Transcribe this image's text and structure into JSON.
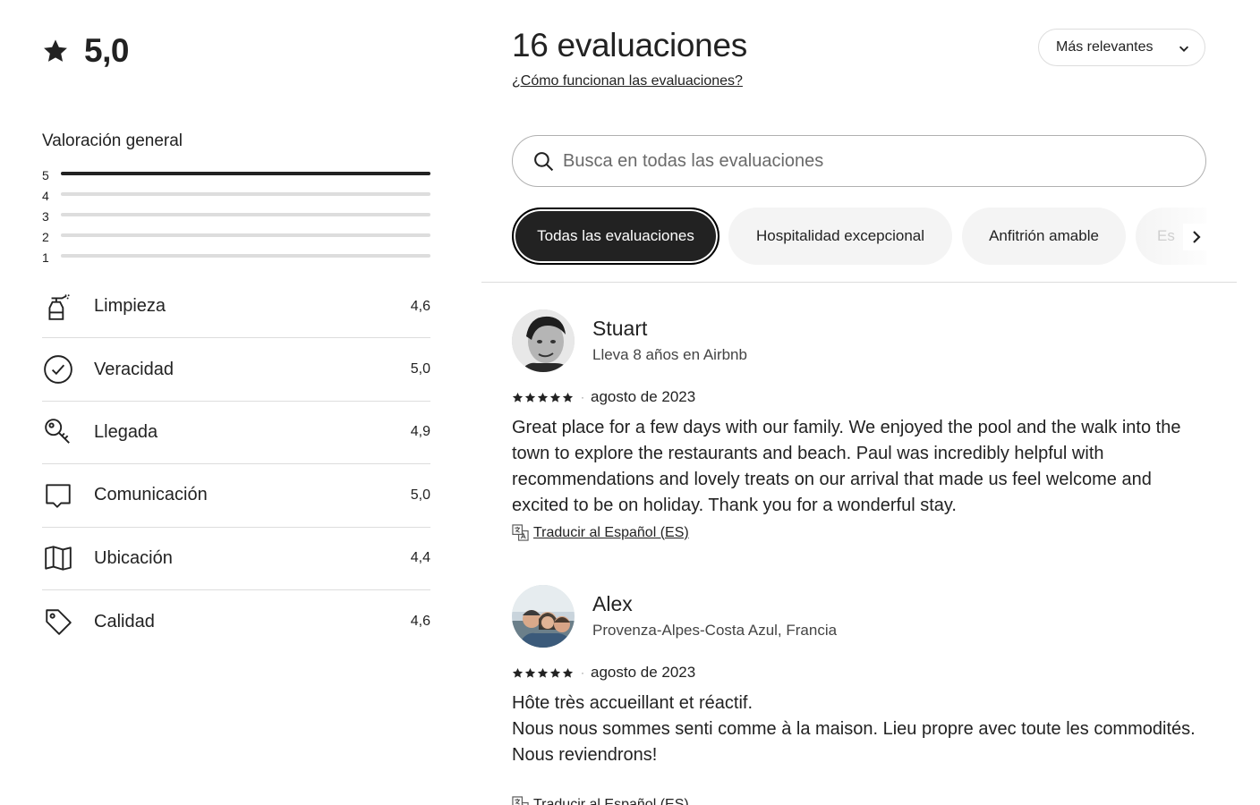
{
  "overall": {
    "rating": "5,0",
    "icon": "star-icon"
  },
  "distribution": {
    "title": "Valoración general",
    "rows": [
      {
        "stars": "5",
        "fraction": 1.0
      },
      {
        "stars": "4",
        "fraction": 0.0
      },
      {
        "stars": "3",
        "fraction": 0.0
      },
      {
        "stars": "2",
        "fraction": 0.0
      },
      {
        "stars": "1",
        "fraction": 0.0
      }
    ]
  },
  "categories": [
    {
      "label": "Limpieza",
      "value": "4,6",
      "icon": "spray-bottle-icon"
    },
    {
      "label": "Veracidad",
      "value": "5,0",
      "icon": "check-circle-icon"
    },
    {
      "label": "Llegada",
      "value": "4,9",
      "icon": "key-icon"
    },
    {
      "label": "Comunicación",
      "value": "5,0",
      "icon": "chat-bubble-icon"
    },
    {
      "label": "Ubicación",
      "value": "4,4",
      "icon": "map-icon"
    },
    {
      "label": "Calidad",
      "value": "4,6",
      "icon": "tag-icon"
    }
  ],
  "header": {
    "title": "16 evaluaciones",
    "how_link": "¿Cómo funcionan las evaluaciones?",
    "sort_label": "Más relevantes"
  },
  "search": {
    "placeholder": "Busca en todas las evaluaciones"
  },
  "chips": [
    {
      "label": "Todas las evaluaciones",
      "active": true
    },
    {
      "label": "Hospitalidad excepcional",
      "active": false
    },
    {
      "label": "Anfitrión amable",
      "active": false
    },
    {
      "label": "Es",
      "active": false
    }
  ],
  "reviews": [
    {
      "name": "Stuart",
      "subtitle": "Lleva 8 años en Airbnb",
      "stars": 5,
      "date": "agosto de 2023",
      "body": "Great place for a few days with our family. We enjoyed the pool and the walk into the town to explore the restaurants and beach. Paul was incredibly helpful with recommendations and lovely treats on our arrival that made us feel welcome and excited to be on holiday. Thank you for a wonderful stay.",
      "translate": "Traducir al Español (ES)"
    },
    {
      "name": "Alex",
      "subtitle": "Provenza-Alpes-Costa Azul, Francia",
      "stars": 5,
      "date": "agosto de 2023",
      "body_lines": [
        "Hôte très accueillant et réactif.",
        "Nous nous sommes senti comme à la maison. Lieu propre avec toute les commodités.",
        "Nous reviendrons!"
      ],
      "translate": "Traducir al Español (ES)"
    }
  ],
  "colors": {
    "text": "#222222",
    "muted": "#6a6a6a",
    "divider": "#dddddd",
    "chip_bg": "#f4f4f4",
    "active_chip": "#222222"
  }
}
